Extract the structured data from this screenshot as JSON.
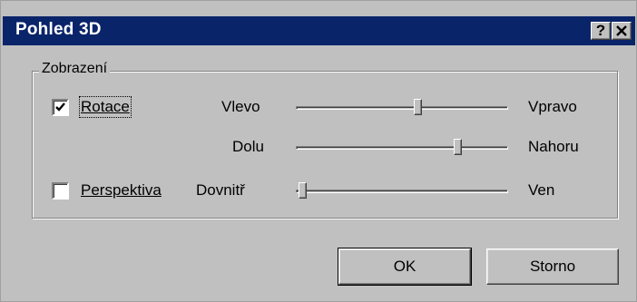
{
  "window": {
    "title": "Pohled 3D",
    "help_glyph": "?",
    "close_glyph": "×"
  },
  "group": {
    "label": "Zobrazení"
  },
  "rotation": {
    "checkbox_label": "Rotace",
    "checked": true,
    "horizontal": {
      "min_label": "Vlevo",
      "max_label": "Vpravo",
      "value_fraction": 0.58
    },
    "vertical": {
      "min_label": "Dolu",
      "max_label": "Nahoru",
      "value_fraction": 0.78
    }
  },
  "perspective": {
    "checkbox_label": "Perspektiva",
    "checked": false,
    "depth": {
      "min_label": "Dovnitř",
      "max_label": "Ven",
      "value_fraction": 0.0
    }
  },
  "buttons": {
    "ok": "OK",
    "cancel": "Storno"
  }
}
